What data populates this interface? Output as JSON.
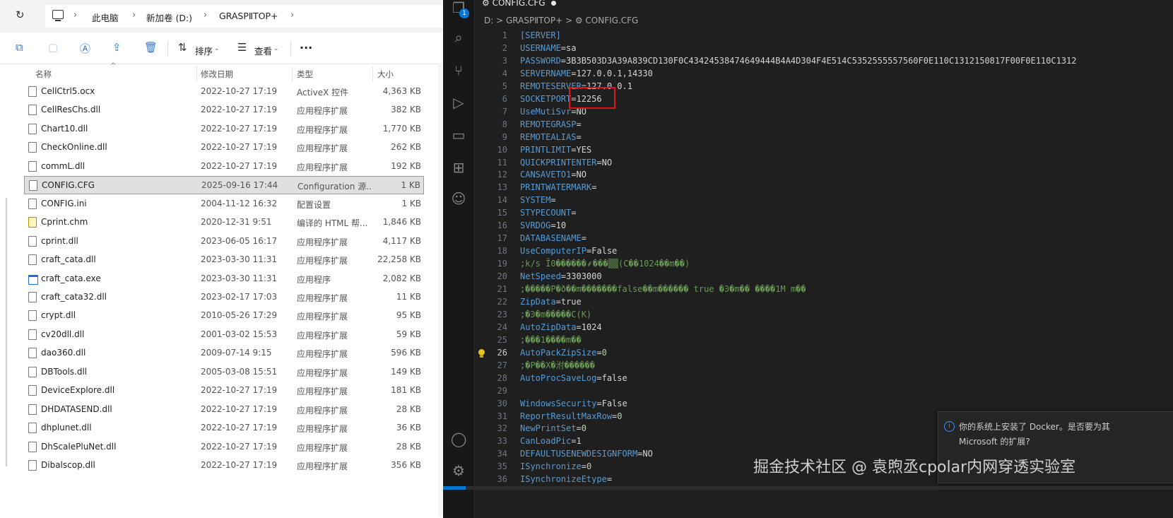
{
  "explorer": {
    "breadcrumb": [
      "此电脑",
      "新加卷 (D:)",
      "GRASPⅡTOP+"
    ],
    "toolbar": {
      "sort_label": "排序",
      "view_label": "查看",
      "more_label": "···"
    },
    "columns": {
      "name": "名称",
      "date": "修改日期",
      "type": "类型",
      "size": "大小"
    },
    "files": [
      {
        "name": "CellCtrl5.ocx",
        "date": "2022-10-27 17:19",
        "type": "ActiveX 控件",
        "size": "4,363 KB"
      },
      {
        "name": "CellResChs.dll",
        "date": "2022-10-27 17:19",
        "type": "应用程序扩展",
        "size": "382 KB"
      },
      {
        "name": "Chart10.dll",
        "date": "2022-10-27 17:19",
        "type": "应用程序扩展",
        "size": "1,770 KB"
      },
      {
        "name": "CheckOnline.dll",
        "date": "2022-10-27 17:19",
        "type": "应用程序扩展",
        "size": "262 KB"
      },
      {
        "name": "commL.dll",
        "date": "2022-10-27 17:19",
        "type": "应用程序扩展",
        "size": "192 KB"
      },
      {
        "name": "CONFIG.CFG",
        "date": "2025-09-16 17:44",
        "type": "Configuration 源...",
        "size": "1 KB",
        "selected": true
      },
      {
        "name": "CONFIG.ini",
        "date": "2004-11-12 16:32",
        "type": "配置设置",
        "size": "1 KB"
      },
      {
        "name": "Cprint.chm",
        "date": "2020-12-31 9:51",
        "type": "编译的 HTML 帮...",
        "size": "1,846 KB",
        "icon": "chm"
      },
      {
        "name": "cprint.dll",
        "date": "2023-06-05 16:17",
        "type": "应用程序扩展",
        "size": "4,117 KB"
      },
      {
        "name": "craft_cata.dll",
        "date": "2023-03-30 11:31",
        "type": "应用程序扩展",
        "size": "22,258 KB"
      },
      {
        "name": "craft_cata.exe",
        "date": "2023-03-30 11:31",
        "type": "应用程序",
        "size": "2,082 KB",
        "icon": "exe"
      },
      {
        "name": "craft_cata32.dll",
        "date": "2023-02-17 17:03",
        "type": "应用程序扩展",
        "size": "11 KB"
      },
      {
        "name": "crypt.dll",
        "date": "2010-05-26 17:29",
        "type": "应用程序扩展",
        "size": "95 KB"
      },
      {
        "name": "cv20dll.dll",
        "date": "2001-03-02 15:53",
        "type": "应用程序扩展",
        "size": "59 KB"
      },
      {
        "name": "dao360.dll",
        "date": "2009-07-14 9:15",
        "type": "应用程序扩展",
        "size": "596 KB"
      },
      {
        "name": "DBTools.dll",
        "date": "2005-03-08 15:51",
        "type": "应用程序扩展",
        "size": "149 KB"
      },
      {
        "name": "DeviceExplore.dll",
        "date": "2022-10-27 17:19",
        "type": "应用程序扩展",
        "size": "181 KB"
      },
      {
        "name": "DHDATASEND.dll",
        "date": "2022-10-27 17:19",
        "type": "应用程序扩展",
        "size": "28 KB"
      },
      {
        "name": "dhplunet.dll",
        "date": "2022-10-27 17:19",
        "type": "应用程序扩展",
        "size": "36 KB"
      },
      {
        "name": "DhScalePluNet.dll",
        "date": "2022-10-27 17:19",
        "type": "应用程序扩展",
        "size": "28 KB"
      },
      {
        "name": "Dibalscop.dll",
        "date": "2022-10-27 17:19",
        "type": "应用程序扩展",
        "size": "356 KB"
      }
    ]
  },
  "vscode": {
    "tab_title": "CONFIG.CFG",
    "breadcrumb": "D: > GRASPⅡTOP+ > ⚙ CONFIG.CFG",
    "extensions_badge": "1",
    "current_line": 26,
    "lines": [
      {
        "n": 1,
        "t": [
          [
            "k",
            "[SERVER]"
          ]
        ]
      },
      {
        "n": 2,
        "t": [
          [
            "k",
            "USERNAME"
          ],
          [
            "o",
            "="
          ],
          [
            "v",
            "sa"
          ]
        ]
      },
      {
        "n": 3,
        "t": [
          [
            "k",
            "PASSWORD"
          ],
          [
            "o",
            "="
          ],
          [
            "v",
            "3B3B503D3A39A839CD130F0C43424538474649444B4A4D304F4E514C5352555557560F0E110C1312150817F00F0E110C1312"
          ]
        ]
      },
      {
        "n": 4,
        "t": [
          [
            "k",
            "SERVERNAME"
          ],
          [
            "o",
            "="
          ],
          [
            "v",
            "127.0.0.1,14330"
          ]
        ]
      },
      {
        "n": 5,
        "t": [
          [
            "k",
            "REMOTESERVER"
          ],
          [
            "o",
            "="
          ],
          [
            "v",
            "127.0.0.1"
          ]
        ]
      },
      {
        "n": 6,
        "t": [
          [
            "k",
            "SOCKETPORT"
          ],
          [
            "o",
            "="
          ],
          [
            "v",
            "12256"
          ]
        ]
      },
      {
        "n": 7,
        "t": [
          [
            "k",
            "UseMutiSvr"
          ],
          [
            "o",
            "="
          ],
          [
            "v",
            "NO"
          ]
        ]
      },
      {
        "n": 8,
        "t": [
          [
            "k",
            "REMOTEGRASP"
          ],
          [
            "o",
            "="
          ]
        ]
      },
      {
        "n": 9,
        "t": [
          [
            "k",
            "REMOTEALIAS"
          ],
          [
            "o",
            "="
          ]
        ]
      },
      {
        "n": 10,
        "t": [
          [
            "k",
            "PRINTLIMIT"
          ],
          [
            "o",
            "="
          ],
          [
            "v",
            "YES"
          ]
        ]
      },
      {
        "n": 11,
        "t": [
          [
            "k",
            "QUICKPRINTENTER"
          ],
          [
            "o",
            "="
          ],
          [
            "v",
            "NO"
          ]
        ]
      },
      {
        "n": 12,
        "t": [
          [
            "k",
            "CANSAVETO1"
          ],
          [
            "o",
            "="
          ],
          [
            "v",
            "NO"
          ]
        ]
      },
      {
        "n": 13,
        "t": [
          [
            "k",
            "PRINTWATERMARK"
          ],
          [
            "o",
            "="
          ]
        ]
      },
      {
        "n": 14,
        "t": [
          [
            "k",
            "SYSTEM"
          ],
          [
            "o",
            "="
          ]
        ]
      },
      {
        "n": 15,
        "t": [
          [
            "k",
            "STYPECOUNT"
          ],
          [
            "o",
            "="
          ]
        ]
      },
      {
        "n": 16,
        "t": [
          [
            "k",
            "SVRDOG"
          ],
          [
            "o",
            "="
          ],
          [
            "v",
            "10"
          ]
        ]
      },
      {
        "n": 17,
        "t": [
          [
            "k",
            "DATABASENAME"
          ],
          [
            "o",
            "="
          ]
        ]
      },
      {
        "n": 18,
        "t": [
          [
            "k",
            "UseComputerIP"
          ],
          [
            "o",
            "="
          ],
          [
            "v",
            "False"
          ]
        ]
      },
      {
        "n": 19,
        "t": [
          [
            "c",
            ";k/s Ï0������⸙���▒▒(C��1024��m��)"
          ]
        ]
      },
      {
        "n": 20,
        "t": [
          [
            "k",
            "NetSpeed"
          ],
          [
            "o",
            "="
          ],
          [
            "v",
            "3303000"
          ]
        ]
      },
      {
        "n": 21,
        "t": [
          [
            "c",
            ";�����P�ð��m�������false��m������ true �Ͽ�m�� ����1M m��"
          ]
        ]
      },
      {
        "n": 22,
        "t": [
          [
            "k",
            "ZipData"
          ],
          [
            "o",
            "="
          ],
          [
            "v",
            "true"
          ]
        ]
      },
      {
        "n": 23,
        "t": [
          [
            "c",
            ";�Ͽ�m�����C(K)"
          ]
        ]
      },
      {
        "n": 24,
        "t": [
          [
            "k",
            "AutoZipData"
          ],
          [
            "o",
            "="
          ],
          [
            "v",
            "1024"
          ]
        ]
      },
      {
        "n": 25,
        "t": [
          [
            "c",
            ";���1����m��"
          ]
        ]
      },
      {
        "n": 26,
        "t": [
          [
            "k",
            "AutoPackZipSize"
          ],
          [
            "o",
            "="
          ],
          [
            "n",
            "0"
          ]
        ]
      },
      {
        "n": 27,
        "t": [
          [
            "c",
            ";�P��X�泭������"
          ]
        ]
      },
      {
        "n": 28,
        "t": [
          [
            "k",
            "AutoProcSaveLog"
          ],
          [
            "o",
            "="
          ],
          [
            "v",
            "false"
          ]
        ]
      },
      {
        "n": 29,
        "t": []
      },
      {
        "n": 30,
        "t": [
          [
            "k",
            "WindowsSecurity"
          ],
          [
            "o",
            "="
          ],
          [
            "v",
            "False"
          ]
        ]
      },
      {
        "n": 31,
        "t": [
          [
            "k",
            "ReportResultMaxRow"
          ],
          [
            "o",
            "="
          ],
          [
            "n",
            "0"
          ]
        ]
      },
      {
        "n": 32,
        "t": [
          [
            "k",
            "NewPrintSet"
          ],
          [
            "o",
            "="
          ],
          [
            "n",
            "0"
          ]
        ]
      },
      {
        "n": 33,
        "t": [
          [
            "k",
            "CanLoadPic"
          ],
          [
            "o",
            "="
          ],
          [
            "v",
            "1"
          ]
        ]
      },
      {
        "n": 34,
        "t": [
          [
            "k",
            "DEFAULTUSENEWDESIGNFORM"
          ],
          [
            "o",
            "="
          ],
          [
            "v",
            "NO"
          ]
        ]
      },
      {
        "n": 35,
        "t": [
          [
            "k",
            "ISynchronize"
          ],
          [
            "o",
            "="
          ],
          [
            "n",
            "0"
          ]
        ]
      },
      {
        "n": 36,
        "t": [
          [
            "k",
            "ISynchronizeEtype"
          ],
          [
            "o",
            "="
          ]
        ]
      }
    ],
    "notification": {
      "line1": "你的系统上安装了 Docker。是否要为其",
      "line2": "Microsoft 的扩展?"
    }
  },
  "watermark": "掘金技术社区 @ 袁煦丞cpolar内网穿透实验室",
  "colors": {
    "accent": "#0078d4",
    "highlight_box": "#e0121b",
    "keyword": "#569cd6",
    "comment": "#6a9955"
  }
}
